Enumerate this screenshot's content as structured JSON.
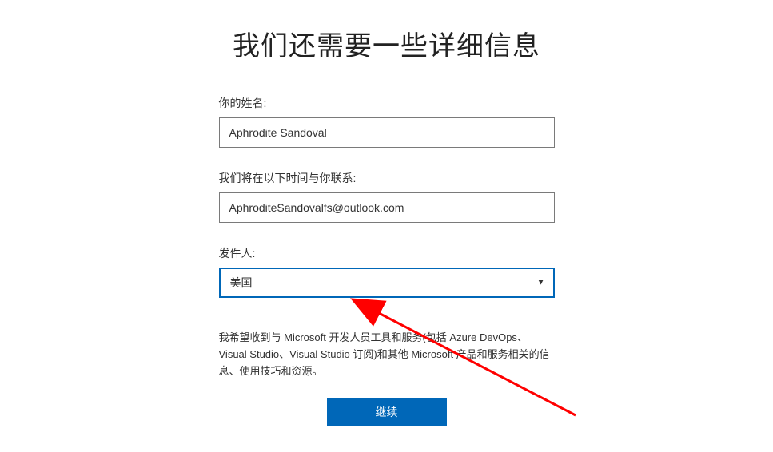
{
  "title": "我们还需要一些详细信息",
  "name": {
    "label": "你的姓名:",
    "value": "Aphrodite Sandoval"
  },
  "contact": {
    "label": "我们将在以下时间与你联系:",
    "value": "AphroditeSandovalfs@outlook.com"
  },
  "sender": {
    "label": "发件人:",
    "value": "美国"
  },
  "consent": "我希望收到与 Microsoft 开发人员工具和服务(包括 Azure DevOps、Visual Studio、Visual Studio 订阅)和其他 Microsoft 产品和服务相关的信息、使用技巧和资源。",
  "continue_label": "继续"
}
